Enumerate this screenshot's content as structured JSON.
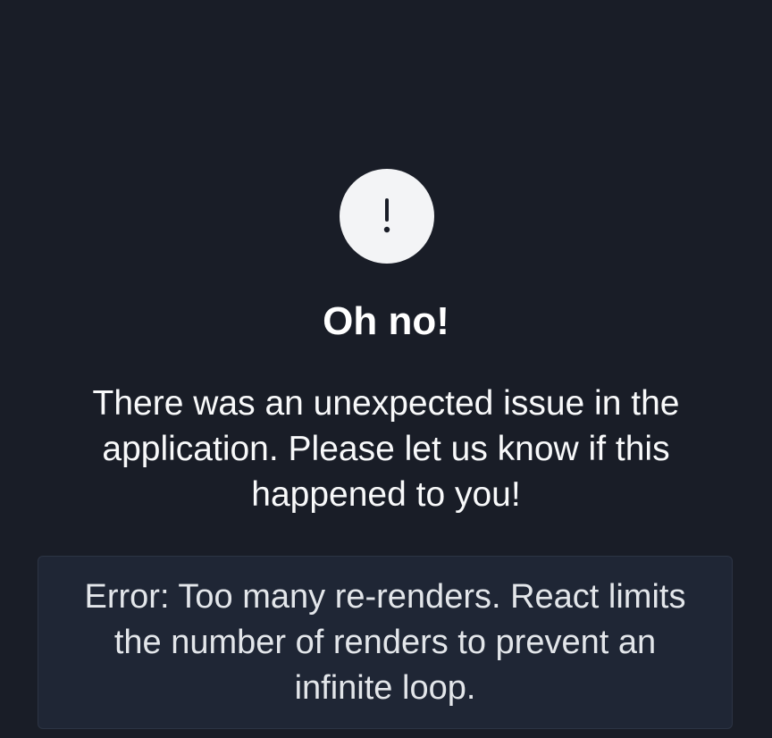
{
  "error_screen": {
    "icon": "exclamation-icon",
    "title": "Oh no!",
    "message": "There was an unexpected issue in the application. Please let us know if this happened to you!",
    "error_detail": "Error: Too many re-renders. React limits the number of renders to prevent an infinite loop."
  },
  "colors": {
    "background": "#191d27",
    "icon_circle": "#f3f4f6",
    "icon_glyph": "#191d27",
    "error_box_background": "#1f2635",
    "error_box_border": "#2c3444"
  }
}
